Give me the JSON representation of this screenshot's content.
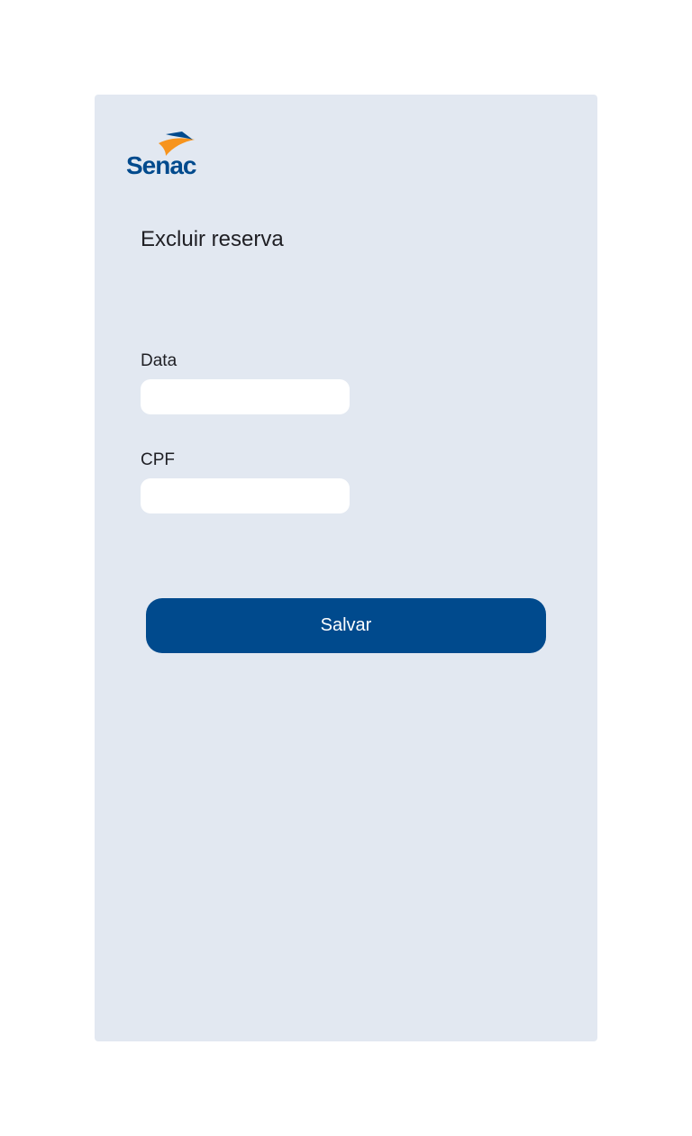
{
  "brand": {
    "logo_text": "Senac",
    "primary_color": "#004a8d",
    "accent_color": "#f7941d",
    "card_background": "#e2e8f1"
  },
  "page": {
    "title": "Excluir reserva"
  },
  "form": {
    "date_label": "Data",
    "date_value": "",
    "cpf_label": "CPF",
    "cpf_value": "",
    "save_label": "Salvar"
  }
}
